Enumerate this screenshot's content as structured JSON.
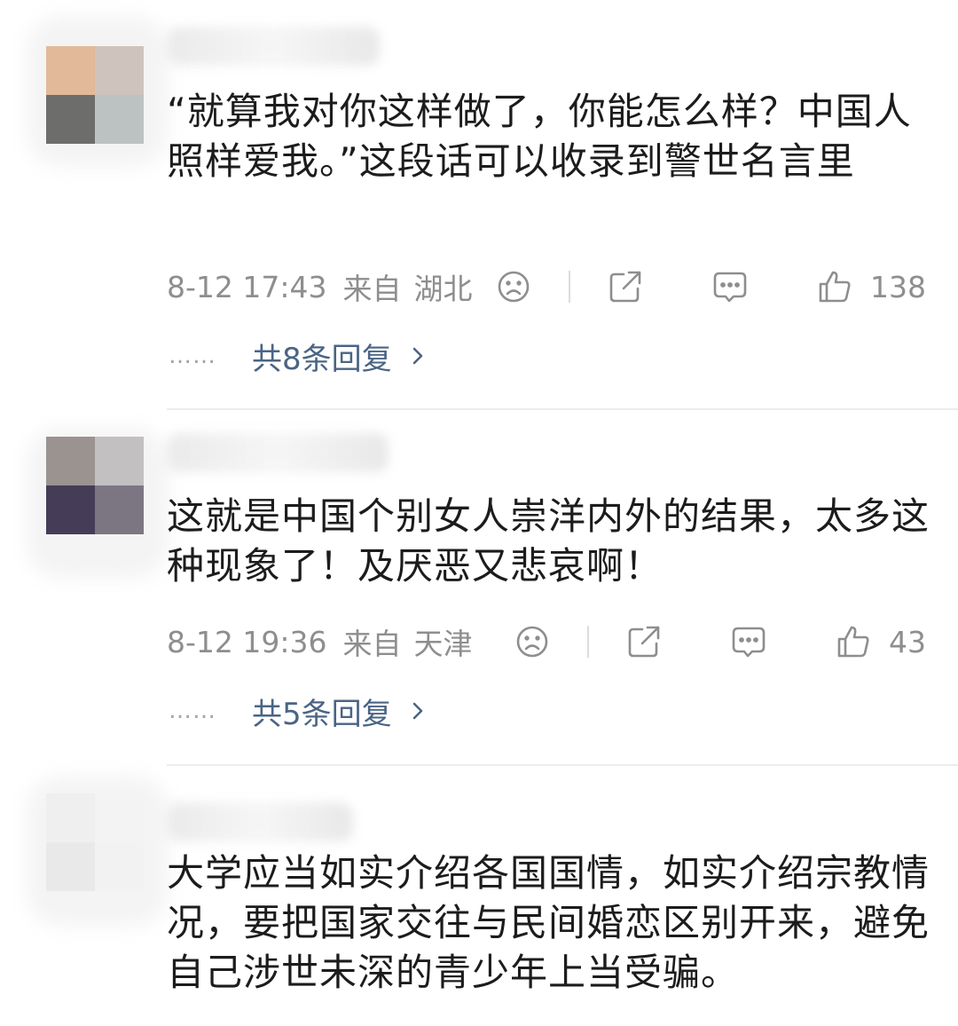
{
  "comments": [
    {
      "text": "“就算我对你这样做了，你能怎么样？中国人照样爱我。”这段话可以收录到警世名言里",
      "time": "8-12 17:43",
      "location_prefix": "来自",
      "location": "湖北",
      "likes": "138",
      "replies": "共8条回复",
      "avatar_colors": [
        "#e2b999",
        "#cfc3bd",
        "#6d6d6b",
        "#bcc2c2"
      ]
    },
    {
      "text": "这就是中国个别女人崇洋内外的结果，太多这种现象了！及厌恶又悲哀啊！",
      "time": "8-12 19:36",
      "location_prefix": "来自",
      "location": "天津",
      "likes": "43",
      "replies": "共5条回复",
      "avatar_colors": [
        "#9a9390",
        "#c2c0c0",
        "#453c58",
        "#7b7682"
      ]
    },
    {
      "text": "大学应当如实介绍各国国情，如实介绍宗教情况，要把国家交往与民间婚恋区别开来，避免自己涉世未深的青少年上当受骗。",
      "avatar_colors": [
        "#efefef",
        "#f3f3f3",
        "#e9e9e9",
        "#f2f2f2"
      ]
    }
  ],
  "icons": {
    "dislike": "frown-face-icon",
    "share": "share-icon",
    "comment": "comment-bubble-icon",
    "like": "thumbs-up-icon",
    "more_replies": "chevron-right-icon"
  },
  "reply_dots": "……",
  "colors": {
    "text": "#1c1c1c",
    "meta": "#8e8e8e",
    "reply_link": "#4a6485",
    "divider": "#ececec"
  }
}
